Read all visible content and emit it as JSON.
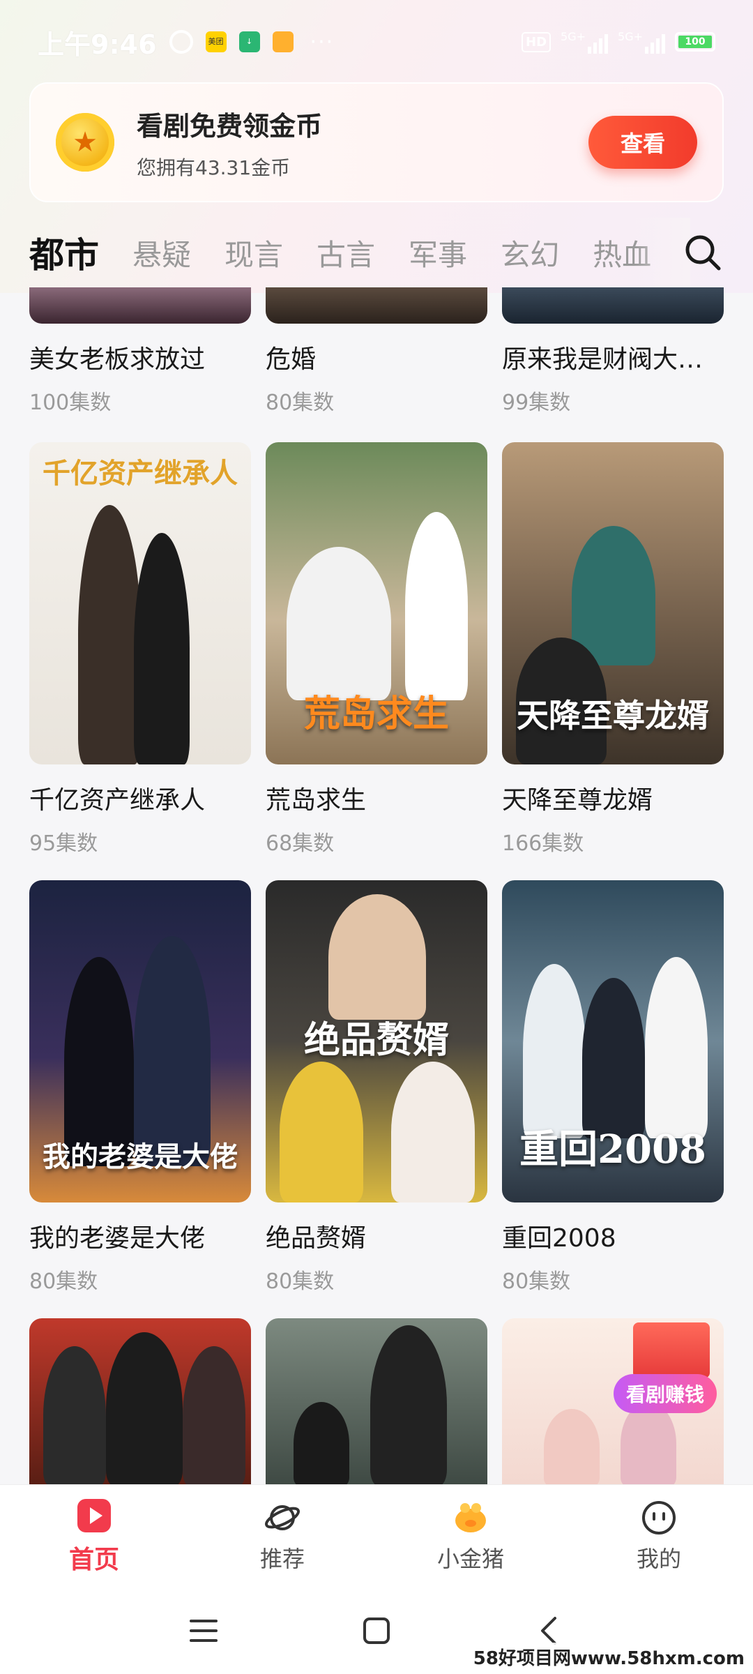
{
  "status_bar": {
    "time": "上午9:46",
    "network_hd": "HD",
    "network_1": "5G+",
    "network_2": "5G+",
    "battery": "100",
    "app_icon_1": "美团"
  },
  "coin_banner": {
    "title": "看剧免费领金币",
    "subtitle": "您拥有43.31金币",
    "button_label": "查看"
  },
  "tabs": [
    {
      "label": "都市",
      "active": true
    },
    {
      "label": "悬疑",
      "active": false
    },
    {
      "label": "现言",
      "active": false
    },
    {
      "label": "古言",
      "active": false
    },
    {
      "label": "军事",
      "active": false
    },
    {
      "label": "玄幻",
      "active": false
    },
    {
      "label": "热血",
      "active": false
    }
  ],
  "dramas_row0": [
    {
      "title": "美女老板求放过",
      "episodes": "100集数"
    },
    {
      "title": "危婚",
      "episodes": "80集数"
    },
    {
      "title": "原来我是财阀大…",
      "episodes": "99集数"
    }
  ],
  "dramas_row1": [
    {
      "title": "千亿资产继承人",
      "episodes": "95集数",
      "poster_text": "千亿资产继承人"
    },
    {
      "title": "荒岛求生",
      "episodes": "68集数",
      "poster_text": "荒岛求生"
    },
    {
      "title": "天降至尊龙婿",
      "episodes": "166集数",
      "poster_text": "天降至尊龙婿"
    }
  ],
  "dramas_row2": [
    {
      "title": "我的老婆是大佬",
      "episodes": "80集数",
      "poster_text": "我的老婆是大佬"
    },
    {
      "title": "绝品赘婿",
      "episodes": "80集数",
      "poster_text": "绝品赘婿"
    },
    {
      "title": "重回2008",
      "episodes": "80集数",
      "poster_text": "重回2008"
    }
  ],
  "earn_badge": "看剧赚钱",
  "bottom_nav": [
    {
      "label": "首页",
      "icon": "play-icon",
      "active": true
    },
    {
      "label": "推荐",
      "icon": "planet-icon",
      "active": false
    },
    {
      "label": "小金猪",
      "icon": "piggy-bank-icon",
      "active": false
    },
    {
      "label": "我的",
      "icon": "smiley-icon",
      "active": false
    }
  ],
  "watermark": "58好项目网www.58hxm.com",
  "colors": {
    "accent": "#f23b4c",
    "button": "#f23b2c",
    "muted": "#9a9a9a"
  }
}
